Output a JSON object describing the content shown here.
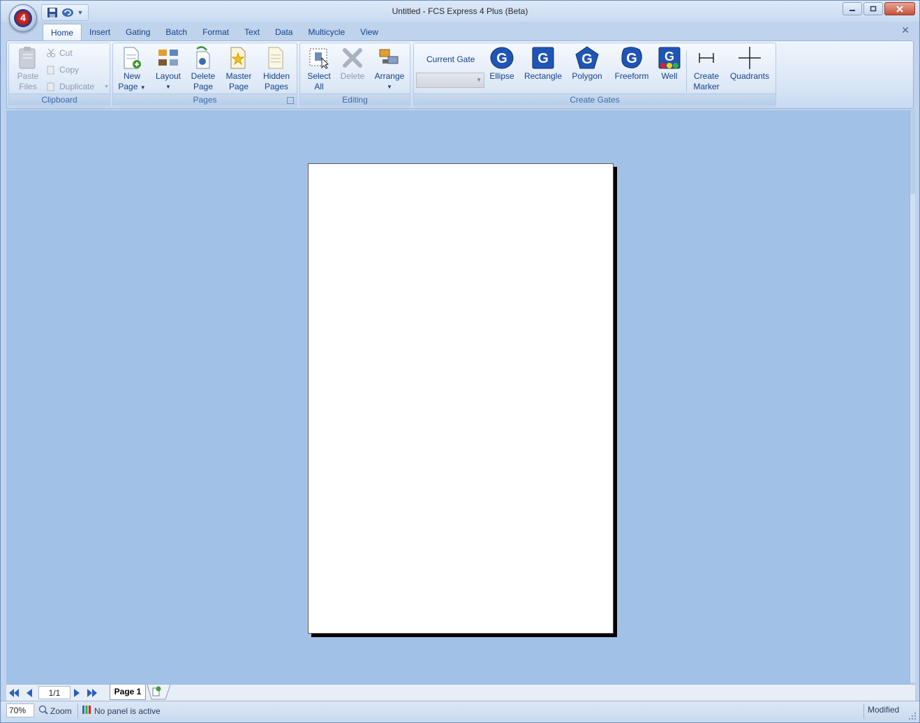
{
  "window": {
    "title": "Untitled - FCS Express 4 Plus (Beta)",
    "app_badge": "4"
  },
  "tabs": [
    {
      "label": "Home"
    },
    {
      "label": "Insert"
    },
    {
      "label": "Gating"
    },
    {
      "label": "Batch"
    },
    {
      "label": "Format"
    },
    {
      "label": "Text"
    },
    {
      "label": "Data"
    },
    {
      "label": "Multicycle"
    },
    {
      "label": "View"
    }
  ],
  "ribbon": {
    "clipboard": {
      "group_label": "Clipboard",
      "paste": "Paste\nFiles",
      "paste_l1": "Paste",
      "paste_l2": "Files",
      "cut": "Cut",
      "copy": "Copy",
      "duplicate": "Duplicate"
    },
    "pages": {
      "group_label": "Pages",
      "new_l1": "New",
      "new_l2": "Page",
      "layout": "Layout",
      "delete_l1": "Delete",
      "delete_l2": "Page",
      "master_l1": "Master",
      "master_l2": "Page",
      "hidden_l1": "Hidden",
      "hidden_l2": "Pages"
    },
    "editing": {
      "group_label": "Editing",
      "select_l1": "Select",
      "select_l2": "All",
      "delete": "Delete",
      "arrange": "Arrange"
    },
    "gates": {
      "group_label": "Create Gates",
      "current_gate": "Current Gate",
      "current_gate_value": "",
      "ellipse": "Ellipse",
      "rectangle": "Rectangle",
      "polygon": "Polygon",
      "freeform": "Freeform",
      "well": "Well",
      "marker_l1": "Create",
      "marker_l2": "Marker",
      "quadrants": "Quadrants"
    }
  },
  "pagebar": {
    "page_counter": "1/1",
    "page_tab": "Page 1"
  },
  "status": {
    "zoom": "70%",
    "zoom_label": "Zoom",
    "panel": "No panel is active",
    "modified": "Modified"
  }
}
